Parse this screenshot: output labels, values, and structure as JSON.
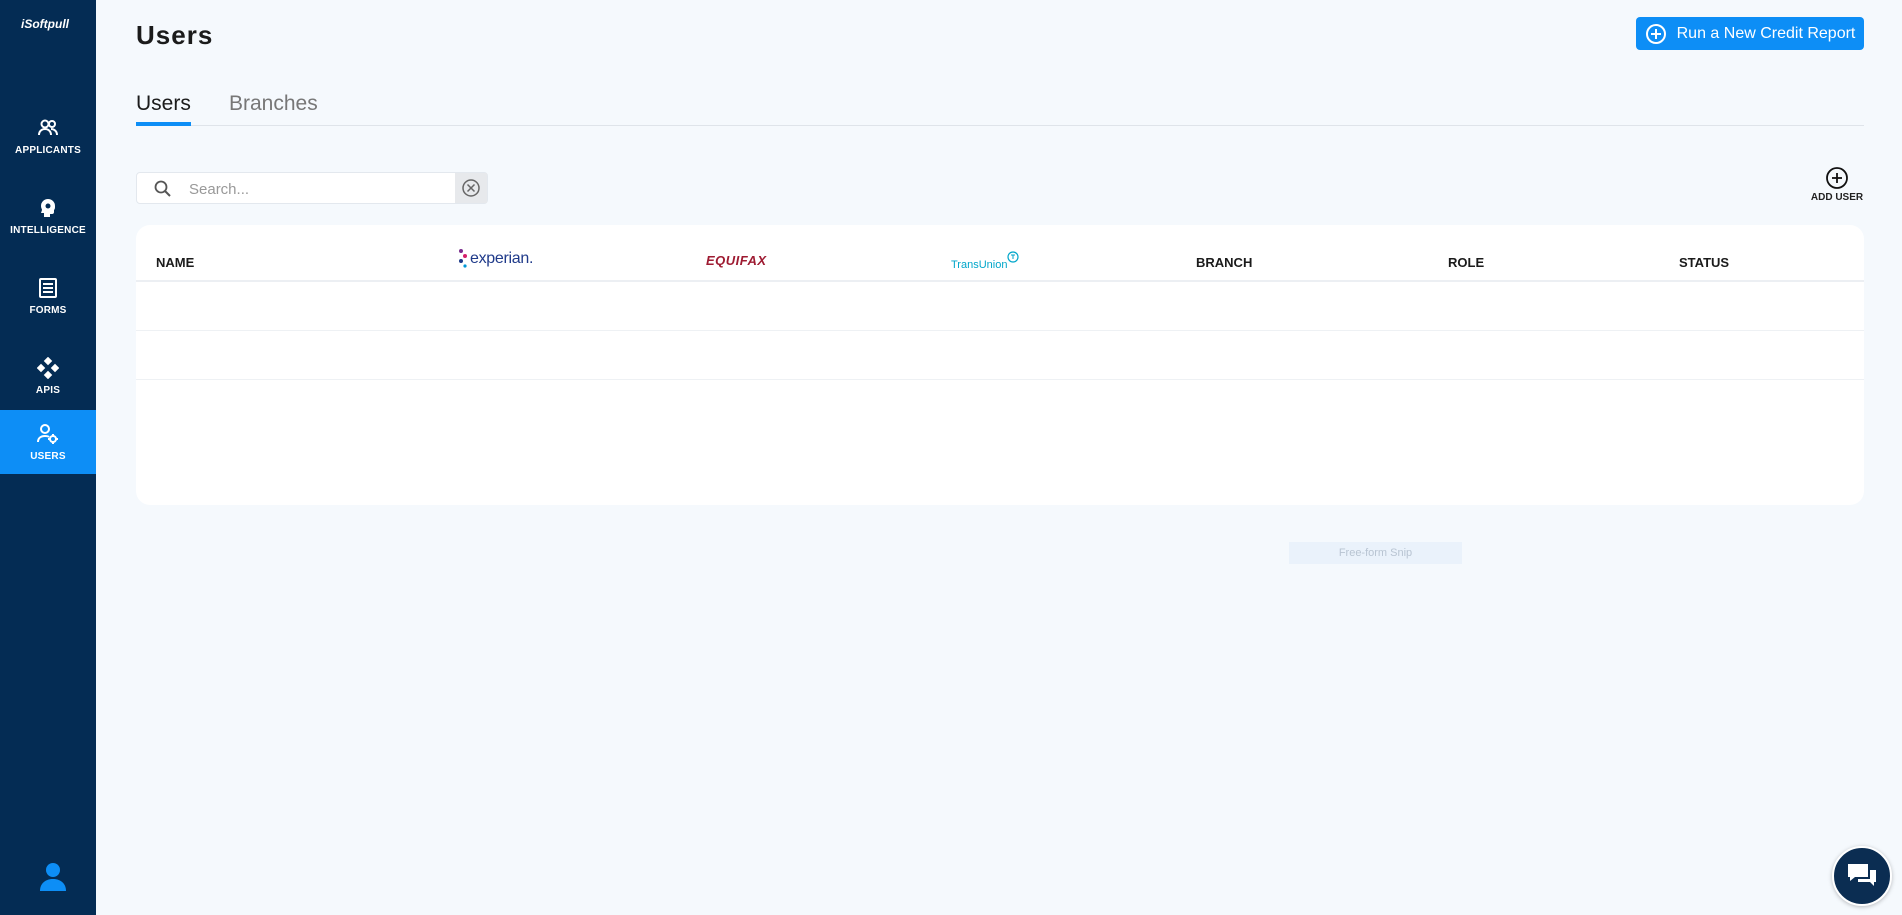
{
  "brand": "iSoftpull",
  "sidebar": {
    "items": [
      {
        "label": "APPLICANTS",
        "icon": "applicants-icon"
      },
      {
        "label": "INTELLIGENCE",
        "icon": "intelligence-icon"
      },
      {
        "label": "FORMS",
        "icon": "forms-icon"
      },
      {
        "label": "APIS",
        "icon": "apis-icon"
      },
      {
        "label": "USERS",
        "icon": "users-icon",
        "active": true
      }
    ]
  },
  "header": {
    "title": "Users",
    "run_report_label": "Run a New Credit Report"
  },
  "tabs": [
    {
      "label": "Users",
      "active": true
    },
    {
      "label": "Branches",
      "active": false
    }
  ],
  "search": {
    "placeholder": "Search...",
    "value": ""
  },
  "add_user_label": "ADD USER",
  "table": {
    "columns": {
      "name": "NAME",
      "experian": "experian.",
      "equifax": "EQUIFAX",
      "transunion": "TransUnion",
      "branch": "BRANCH",
      "role": "ROLE",
      "status": "STATUS"
    },
    "rows": []
  },
  "snip_label": "Free-form Snip",
  "colors": {
    "sidebar_bg": "#042c54",
    "accent": "#0d8ef6",
    "page_bg": "#f5f9fd"
  }
}
